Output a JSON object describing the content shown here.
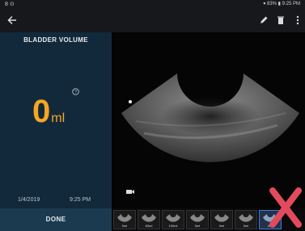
{
  "status_bar": {
    "left": "8 ⊙",
    "right": "▾ 83% ▮ 9:25 PM"
  },
  "panel": {
    "title": "BLADDER VOLUME",
    "volume_value": "0",
    "volume_unit": "ml",
    "date": "1/4/2019",
    "time": "9:25 PM",
    "done_label": "DONE"
  },
  "icons": [
    "back-arrow-icon",
    "pencil-icon",
    "trash-icon",
    "more-vertical-icon",
    "help-icon",
    "camera-icon"
  ],
  "filmstrip": {
    "thumbs": [
      "0ml",
      "83ml",
      "100ml",
      "0ml",
      "0ml",
      "0ml",
      "0ml"
    ]
  },
  "colors": {
    "panel_bg": "#12293b",
    "accent": "#f5a623",
    "done_bg": "#1c3a4f",
    "x_mark": "#e34b5c"
  }
}
